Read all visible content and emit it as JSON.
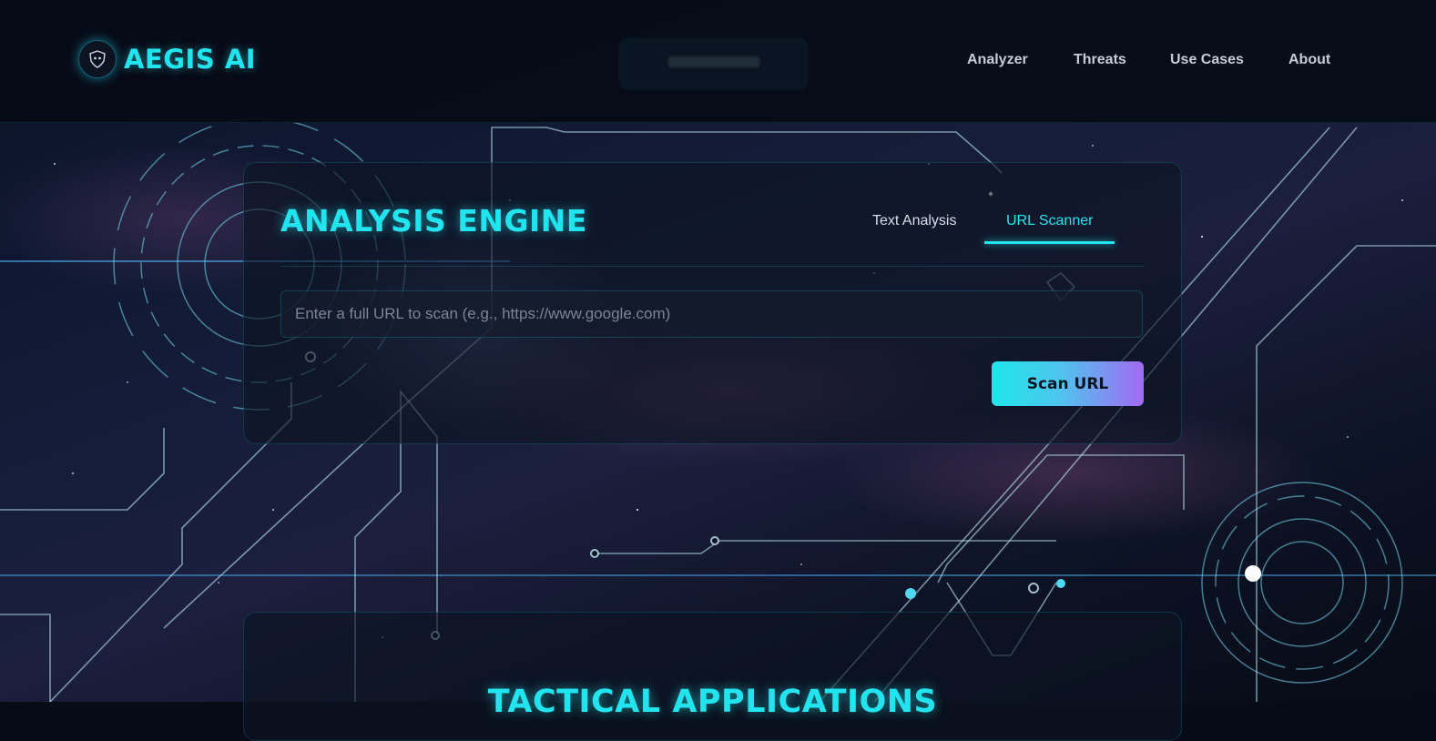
{
  "header": {
    "brand": "AEGIS AI",
    "logo_icon": "shield-robot-icon",
    "nav": [
      "Analyzer",
      "Threats",
      "Use Cases",
      "About"
    ]
  },
  "analysis": {
    "title": "ANALYSIS ENGINE",
    "tabs": [
      "Text Analysis",
      "URL Scanner"
    ],
    "active_tab": "URL Scanner",
    "url_input_value": "",
    "url_placeholder": "Enter a full URL to scan (e.g., https://www.google.com)",
    "scan_button": "Scan URL"
  },
  "next_section": {
    "title": "TACTICAL APPLICATIONS"
  },
  "colors": {
    "accent": "#22e4ee",
    "gradient_end": "#a26af2",
    "background": "#070b16"
  }
}
